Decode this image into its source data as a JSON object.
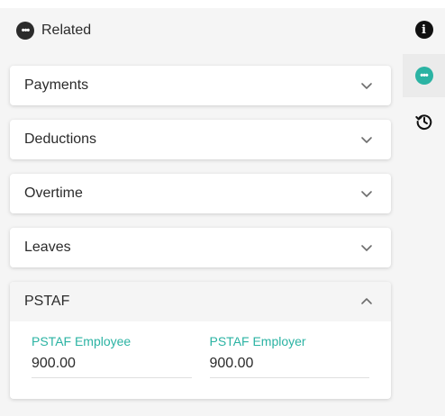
{
  "header": {
    "title": "Related",
    "icon": "more-horizontal-icon"
  },
  "sections": [
    {
      "title": "Payments",
      "expanded": false
    },
    {
      "title": "Deductions",
      "expanded": false
    },
    {
      "title": "Overtime",
      "expanded": false
    },
    {
      "title": "Leaves",
      "expanded": false
    },
    {
      "title": "PSTAF",
      "expanded": true
    }
  ],
  "pstaf": {
    "employee": {
      "label": "PSTAF Employee",
      "value": "900.00"
    },
    "employer": {
      "label": "PSTAF Employer",
      "value": "900.00"
    }
  },
  "rail": {
    "items": [
      {
        "name": "info-icon",
        "active": false
      },
      {
        "name": "related-icon",
        "active": true
      },
      {
        "name": "history-icon",
        "active": false
      }
    ]
  },
  "colors": {
    "accent": "#2bb3a3",
    "text": "#2b2b2b",
    "panel": "#f5f5f5",
    "active_rail": "#ebebeb"
  }
}
